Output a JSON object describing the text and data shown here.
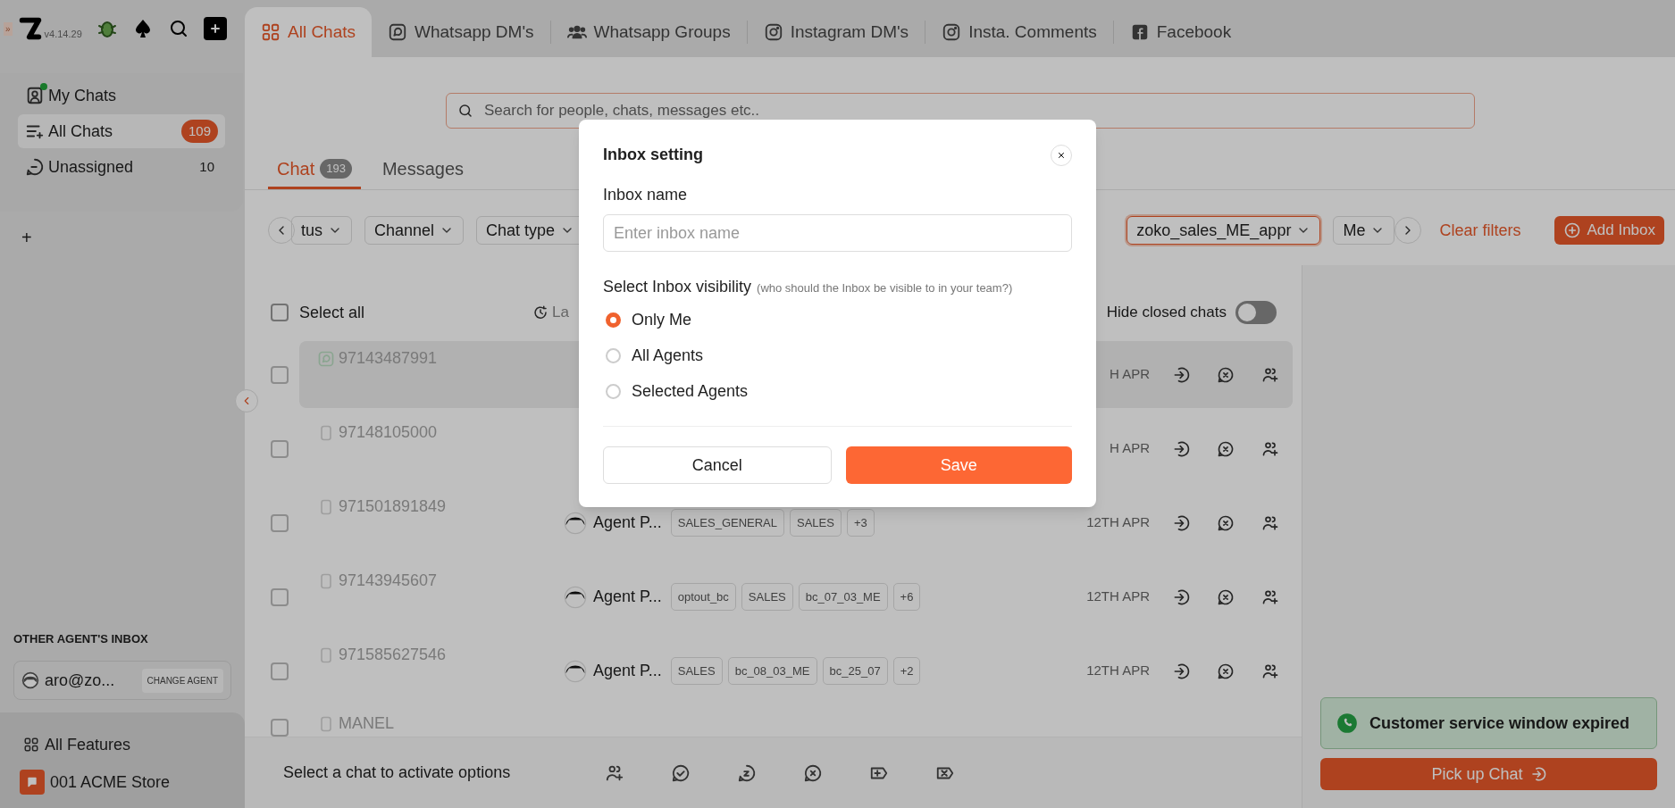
{
  "sidebar": {
    "expand": "»",
    "version": "v4.14.29",
    "nav": [
      {
        "label": "My Chats",
        "kind": "mine",
        "selected": false
      },
      {
        "label": "All Chats",
        "kind": "all",
        "count": "109",
        "selected": true
      },
      {
        "label": "Unassigned",
        "kind": "unassigned",
        "count": "10",
        "selected": false
      }
    ],
    "add": "+",
    "section_title": "OTHER AGENT'S INBOX",
    "agent": {
      "email": "aro@zo...",
      "button": "CHANGE AGENT"
    },
    "footer": [
      {
        "label": "All Features",
        "kind": "features"
      },
      {
        "label": "001 ACME Store",
        "kind": "store"
      }
    ]
  },
  "tabs": [
    {
      "label": "All Chats",
      "kind": "grid",
      "selected": true
    },
    {
      "label": "Whatsapp DM's",
      "kind": "whatsapp",
      "selected": false
    },
    {
      "label": "Whatsapp Groups",
      "kind": "group",
      "selected": false
    },
    {
      "label": "Instagram DM's",
      "kind": "instagram",
      "selected": false
    },
    {
      "label": "Insta. Comments",
      "kind": "instagram",
      "selected": false
    },
    {
      "label": "Facebook",
      "kind": "facebook",
      "selected": false
    }
  ],
  "search": {
    "placeholder": "Search for people, chats, messages etc.."
  },
  "view_tabs": [
    {
      "label": "Chat",
      "count": "193",
      "selected": true
    },
    {
      "label": "Messages",
      "selected": false
    }
  ],
  "filters_left": [
    {
      "label": "tus",
      "highlighted": false
    },
    {
      "label": "Channel",
      "highlighted": false
    },
    {
      "label": "Chat type",
      "highlighted": false
    }
  ],
  "filters_right": [
    {
      "label": "zoko_sales_ME_appr",
      "highlighted": true
    },
    {
      "label": "Me",
      "highlighted": false
    }
  ],
  "clear_filters": "Clear filters",
  "add_inbox": "Add Inbox",
  "list": {
    "select_all": "Select all",
    "select_all_checked": false,
    "sort_label": "La",
    "hide_closed": {
      "label": "Hide closed chats",
      "on": false
    },
    "rows": [
      {
        "number": "97143487991",
        "selected": true,
        "checked": false,
        "date": "H APR"
      },
      {
        "number": "97148105000",
        "selected": false,
        "checked": false,
        "date": "H APR"
      },
      {
        "number": "971501891849",
        "selected": false,
        "checked": false,
        "agent": "Agent P...",
        "tags": [
          "SALES_GENERAL",
          "SALES",
          "+3"
        ],
        "date": "12TH APR"
      },
      {
        "number": "97143945607",
        "selected": false,
        "checked": false,
        "agent": "Agent P...",
        "tags": [
          "optout_bc",
          "SALES",
          "bc_07_03_ME",
          "+6"
        ],
        "date": "12TH APR"
      },
      {
        "number": "971585627546",
        "selected": false,
        "checked": false,
        "agent": "Agent P...",
        "tags": [
          "SALES",
          "bc_08_03_ME",
          "bc_25_07",
          "+2"
        ],
        "date": "12TH APR"
      },
      {
        "number": "MANEL",
        "selected": false,
        "checked": false
      }
    ]
  },
  "action_bar": {
    "text": "Select a chat to activate options"
  },
  "notice": "Customer service window expired",
  "pick_up": "Pick up Chat",
  "modal": {
    "title": "Inbox setting",
    "name_label": "Inbox name",
    "name_placeholder": "Enter inbox name",
    "visibility_label": "Select Inbox visibility",
    "visibility_hint": "(who should the Inbox be visible to in your team?)",
    "options": [
      {
        "label": "Only Me",
        "selected": true
      },
      {
        "label": "All Agents",
        "selected": false
      },
      {
        "label": "Selected Agents",
        "selected": false
      }
    ],
    "cancel": "Cancel",
    "save": "Save"
  }
}
